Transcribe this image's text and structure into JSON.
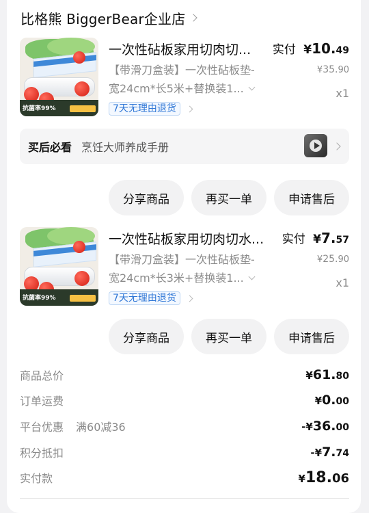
{
  "shop": {
    "name": "比格熊 BiggerBear企业店",
    "icon": "chevron-right-icon"
  },
  "items": [
    {
      "title": "一次性砧板家用切肉切...",
      "spec_line1": "【带滑刀盒装】一次性砧板垫-",
      "spec_line2": "宽24cm*长5米+替换装1...",
      "return_tag": "7天无理由退货",
      "pay_label": "实付",
      "pay_currency": "¥",
      "pay_int": "10.",
      "pay_dec": "49",
      "orig_currency": "¥",
      "orig_int": "35.",
      "orig_dec": "90",
      "qty": "x1",
      "thumb_text": "抗菌率99%"
    },
    {
      "title": "一次性砧板家用切肉切水...",
      "spec_line1": "【带滑刀盒装】一次性砧板垫-",
      "spec_line2": "宽24cm*长3米+替换装1...",
      "return_tag": "7天无理由退货",
      "pay_label": "实付",
      "pay_currency": "¥",
      "pay_int": "7.",
      "pay_dec": "57",
      "orig_currency": "¥",
      "orig_int": "25.",
      "orig_dec": "90",
      "qty": "x1",
      "thumb_text": "抗菌率99%"
    }
  ],
  "must_read": {
    "label": "买后必看",
    "text": "烹饪大师养成手册"
  },
  "actions": {
    "share": "分享商品",
    "rebuy": "再买一单",
    "after_sale": "申请售后"
  },
  "summary": {
    "goods_total": {
      "label": "商品总价",
      "sign": "",
      "cur": "¥",
      "int": "61.",
      "dec": "80"
    },
    "shipping": {
      "label": "订单运费",
      "sign": "",
      "cur": "¥",
      "int": "0.",
      "dec": "00"
    },
    "platform_discount": {
      "label": "平台优惠",
      "note": "满60减36",
      "sign": "-",
      "cur": "¥",
      "int": "36.",
      "dec": "00"
    },
    "points": {
      "label": "积分抵扣",
      "sign": "-",
      "cur": "¥",
      "int": "7.",
      "dec": "74"
    },
    "paid": {
      "label": "实付款",
      "sign": "",
      "cur": "¥",
      "int": "18.",
      "dec": "06"
    }
  },
  "colors": {
    "link_blue": "#2e76d6",
    "muted": "#8a8a8a",
    "card_bg": "#ffffff",
    "page_bg": "#f2f2f4"
  }
}
